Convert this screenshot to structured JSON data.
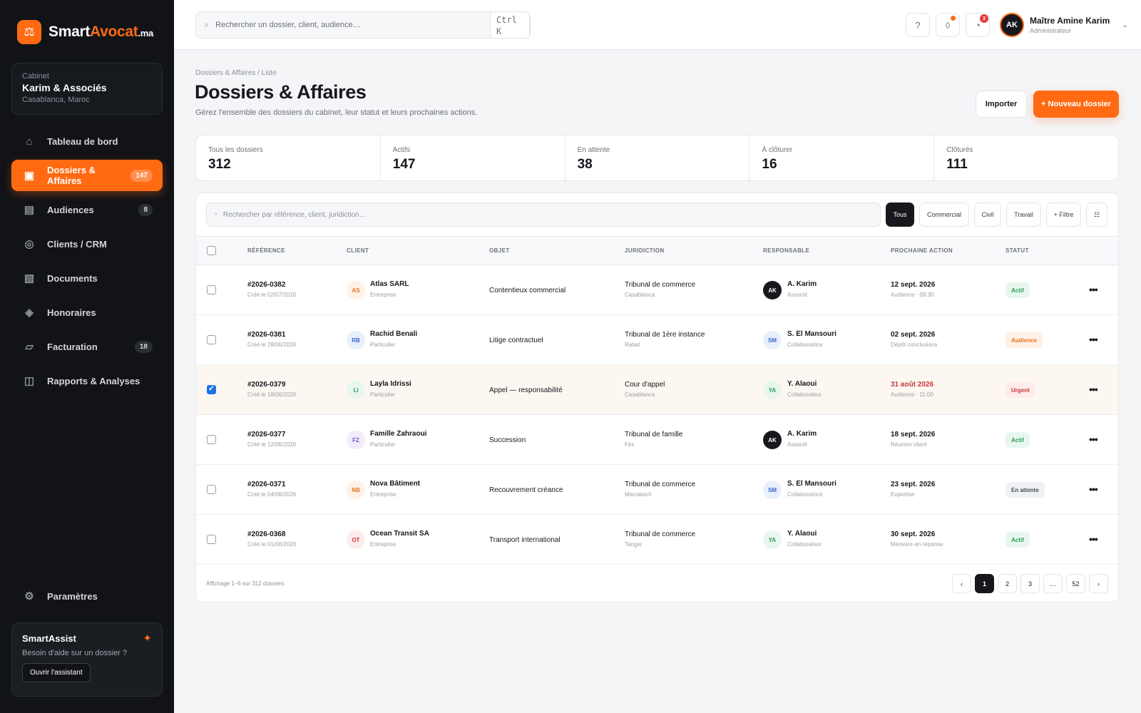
{
  "brand": {
    "name_main": "Smart",
    "name_accent": "Avocat",
    "name_tld": ".ma",
    "logo_glyph": "⚖",
    "accent_color": "#ff6a13"
  },
  "cabinet": {
    "label": "Cabinet",
    "name": "Karim & Associés",
    "location": "Casablanca, Maroc"
  },
  "nav": [
    {
      "label": "Tableau de bord",
      "icon": "home-icon",
      "glyph": "⌂",
      "badge": ""
    },
    {
      "label": "Dossiers & Affaires",
      "icon": "folder-icon",
      "glyph": "▣",
      "badge": "147",
      "active": true
    },
    {
      "label": "Audiences",
      "icon": "calendar-icon",
      "glyph": "▤",
      "badge": "8"
    },
    {
      "label": "Clients / CRM",
      "icon": "clients-icon",
      "glyph": "◎",
      "badge": ""
    },
    {
      "label": "Documents",
      "icon": "documents-icon",
      "glyph": "▧",
      "badge": ""
    },
    {
      "label": "Honoraires",
      "icon": "fees-icon",
      "glyph": "◈",
      "badge": ""
    },
    {
      "label": "Facturation",
      "icon": "invoice-icon",
      "glyph": "▱",
      "badge": "18"
    },
    {
      "label": "Rapports & Analyses",
      "icon": "reports-icon",
      "glyph": "◫",
      "badge": ""
    }
  ],
  "settings": {
    "label": "Paramètres",
    "icon": "gear-icon",
    "glyph": "⚙"
  },
  "assist": {
    "title": "SmartAssist",
    "desc": "Besoin d'aide sur un dossier ?",
    "button": "Ouvrir l'assistant",
    "glyph": "✦"
  },
  "topbar": {
    "search_placeholder": "Rechercher un dossier, client, audience…",
    "shortcut": "Ctrl K",
    "help": "?",
    "notif_count": "3",
    "user_name": "Maître Amine Karim",
    "user_role": "Administrateur",
    "user_initials": "AK"
  },
  "page": {
    "breadcrumb": "Dossiers & Affaires / Liste",
    "title": "Dossiers & Affaires",
    "subtitle": "Gérez l'ensemble des dossiers du cabinet, leur statut et leurs prochaines actions.",
    "import_label": "Importer",
    "new_label": "+ Nouveau dossier"
  },
  "stats": [
    {
      "label": "Tous les dossiers",
      "value": "312"
    },
    {
      "label": "Actifs",
      "value": "147"
    },
    {
      "label": "En attente",
      "value": "38"
    },
    {
      "label": "À clôturer",
      "value": "16"
    },
    {
      "label": "Clôturés",
      "value": "111"
    }
  ],
  "filters": {
    "search_placeholder": "Rechercher par référence, client, juridiction…",
    "chips": [
      "Tous",
      "Commercial",
      "Civil",
      "Travail",
      "+ Filtre"
    ],
    "active_chip": "Tous"
  },
  "columns": [
    "Référence",
    "Client",
    "Objet",
    "Juridiction",
    "Responsable",
    "Prochaine action",
    "Statut"
  ],
  "rows": [
    {
      "ref": "#2026-0382",
      "created": "Créé le 02/07/2026",
      "cli_initials": "AS",
      "client": "Atlas SARL",
      "client_type": "Entreprise",
      "cli_bg": "#fff1e6",
      "cli_fg": "#e8741f",
      "objet": "Contentieux commercial",
      "juridiction": "Tribunal de commerce",
      "ville": "Casablanca",
      "resp_initials": "AK",
      "responsable": "A. Karim",
      "resp_role": "Associé",
      "resp_bg": "#16181d",
      "resp_fg": "#ffffff",
      "date": "12 sept. 2026",
      "detail": "Audience · 09:30",
      "urgent": false,
      "status": "Actif",
      "st_bg": "#e8f7ee",
      "st_fg": "#2a9a5a",
      "checked": false
    },
    {
      "ref": "#2026-0381",
      "created": "Créé le 28/06/2026",
      "cli_initials": "RB",
      "client": "Rachid Benali",
      "client_type": "Particulier",
      "cli_bg": "#e9f0fd",
      "cli_fg": "#3a64c8",
      "objet": "Litige contractuel",
      "juridiction": "Tribunal de 1ère instance",
      "ville": "Rabat",
      "resp_initials": "SM",
      "responsable": "S. El Mansouri",
      "resp_role": "Collaboratrice",
      "resp_bg": "#e9f0fd",
      "resp_fg": "#3a64c8",
      "date": "02 sept. 2026",
      "detail": "Dépôt conclusions",
      "urgent": false,
      "status": "Audience",
      "st_bg": "#fff1e6",
      "st_fg": "#e8741f",
      "checked": false
    },
    {
      "ref": "#2026-0379",
      "created": "Créé le 18/06/2026",
      "cli_initials": "LI",
      "client": "Layla Idrissi",
      "client_type": "Particulier",
      "cli_bg": "#e8f7ee",
      "cli_fg": "#2a9a5a",
      "objet": "Appel — responsabilité",
      "juridiction": "Cour d'appel",
      "ville": "Casablanca",
      "resp_initials": "YA",
      "responsable": "Y. Alaoui",
      "resp_role": "Collaborateur",
      "resp_bg": "#e8f7ee",
      "resp_fg": "#2a9a5a",
      "date": "31 août 2026",
      "detail": "Audience · 11:00",
      "urgent": true,
      "status": "Urgent",
      "st_bg": "#fdeceb",
      "st_fg": "#c83838",
      "checked": true
    },
    {
      "ref": "#2026-0377",
      "created": "Créé le 12/06/2026",
      "cli_initials": "FZ",
      "client": "Famille Zahraoui",
      "client_type": "Particulier",
      "cli_bg": "#f2ecfb",
      "cli_fg": "#7a52c0",
      "objet": "Succession",
      "juridiction": "Tribunal de famille",
      "ville": "Fès",
      "resp_initials": "AK",
      "responsable": "A. Karim",
      "resp_role": "Associé",
      "resp_bg": "#16181d",
      "resp_fg": "#ffffff",
      "date": "18 sept. 2026",
      "detail": "Réunion client",
      "urgent": false,
      "status": "Actif",
      "st_bg": "#e8f7ee",
      "st_fg": "#2a9a5a",
      "checked": false
    },
    {
      "ref": "#2026-0371",
      "created": "Créé le 04/06/2026",
      "cli_initials": "NB",
      "client": "Nova Bâtiment",
      "client_type": "Entreprise",
      "cli_bg": "#fff1e6",
      "cli_fg": "#e8741f",
      "objet": "Recouvrement créance",
      "juridiction": "Tribunal de commerce",
      "ville": "Marrakech",
      "resp_initials": "SM",
      "responsable": "S. El Mansouri",
      "resp_role": "Collaboratrice",
      "resp_bg": "#e9f0fd",
      "resp_fg": "#3a64c8",
      "date": "23 sept. 2026",
      "detail": "Expertise",
      "urgent": false,
      "status": "En attente",
      "st_bg": "#f0f1f4",
      "st_fg": "#4a4e57",
      "checked": false
    },
    {
      "ref": "#2026-0368",
      "created": "Créé le 01/06/2026",
      "cli_initials": "OT",
      "client": "Ocean Transit SA",
      "client_type": "Entreprise",
      "cli_bg": "#fdeceb",
      "cli_fg": "#c83838",
      "objet": "Transport international",
      "juridiction": "Tribunal de commerce",
      "ville": "Tanger",
      "resp_initials": "YA",
      "responsable": "Y. Alaoui",
      "resp_role": "Collaborateur",
      "resp_bg": "#e8f7ee",
      "resp_fg": "#2a9a5a",
      "date": "30 sept. 2026",
      "detail": "Mémoire en réponse",
      "urgent": false,
      "status": "Actif",
      "st_bg": "#e8f7ee",
      "st_fg": "#2a9a5a",
      "checked": false
    }
  ],
  "footer": {
    "info": "Affichage 1–6 sur 312 dossiers",
    "pages": [
      "‹",
      "1",
      "2",
      "3",
      "…",
      "52",
      "›"
    ],
    "current_page": "1"
  }
}
